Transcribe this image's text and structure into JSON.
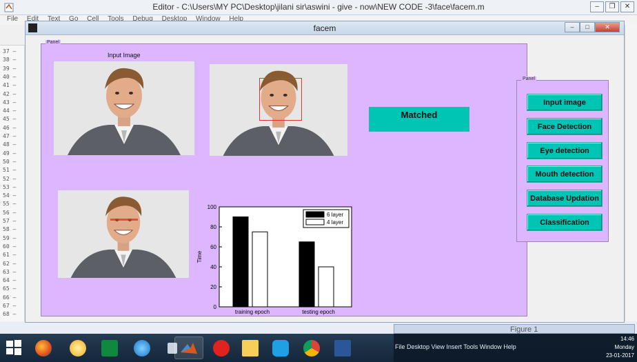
{
  "editor": {
    "title": "Editor - C:\\Users\\MY PC\\Desktop\\jilani sir\\aswini - give - now\\NEW CODE -3\\face\\facem.m",
    "menu": [
      "File",
      "Edit",
      "Text",
      "Go",
      "Cell",
      "Tools",
      "Debug",
      "Desktop",
      "Window",
      "Help"
    ],
    "line_numbers": [
      "37",
      "38",
      "39",
      "40",
      "41",
      "42",
      "43",
      "44",
      "45",
      "46",
      "47",
      "48",
      "49",
      "50",
      "51",
      "52",
      "53",
      "54",
      "55",
      "56",
      "57",
      "58",
      "59",
      "60",
      "61",
      "62",
      "63",
      "64",
      "65",
      "66",
      "67",
      "68"
    ]
  },
  "figure": {
    "title": "facem",
    "main_panel_label": "Panel",
    "side_panel_label": "Panel",
    "input_image_caption": "Input Image",
    "matched_label": "Matched",
    "buttons": [
      "Input image",
      "Face Detection",
      "Eye detection",
      "Mouth detection",
      "Database Updation",
      "Classification"
    ]
  },
  "chart_data": {
    "type": "bar",
    "categories": [
      "training epoch",
      "testing epoch"
    ],
    "series": [
      {
        "name": "6 layer",
        "values": [
          90,
          65
        ],
        "color": "#000000"
      },
      {
        "name": "4 layer",
        "values": [
          75,
          40
        ],
        "color": "#ffffff"
      }
    ],
    "ylabel": "Time",
    "xlabel": "",
    "ylim": [
      0,
      100
    ],
    "yticks": [
      0,
      20,
      40,
      60,
      80,
      100
    ],
    "legend_position": "top-right"
  },
  "figure1": {
    "title": "Figure 1"
  },
  "tray": {
    "text": "File  Desktop  View  Insert  Tools  Window  Help",
    "time": "14:46",
    "day": "Monday",
    "date": "23-01-2017"
  }
}
